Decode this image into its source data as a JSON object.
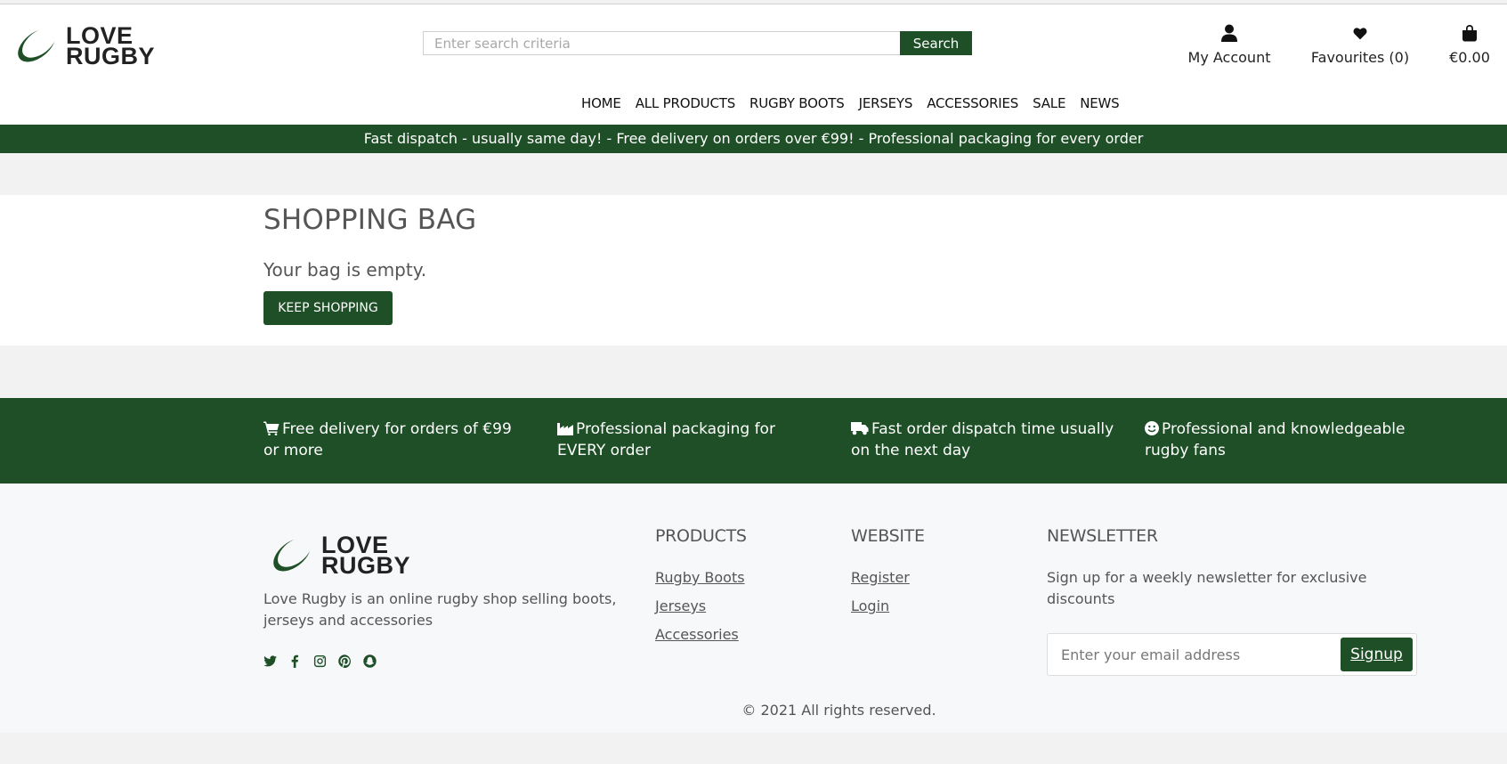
{
  "brand": {
    "line1": "LOVE",
    "line2": "RUGBY",
    "accent": "#1e4f27"
  },
  "search": {
    "placeholder": "Enter search criteria",
    "button_label": "Search"
  },
  "header_links": {
    "account_label": "My Account",
    "favourites_label": "Favourites (0)",
    "bag_total": "€0.00"
  },
  "nav": [
    "HOME",
    "ALL PRODUCTS",
    "RUGBY BOOTS",
    "JERSEYS",
    "ACCESSORIES",
    "SALE",
    "NEWS"
  ],
  "promo_text": "Fast dispatch - usually same day! - Free delivery on orders over €99! - Professional packaging for every order",
  "bag": {
    "title": "SHOPPING BAG",
    "empty_message": "Your bag is empty.",
    "keep_shopping_label": "KEEP SHOPPING"
  },
  "features": [
    {
      "icon": "cart-icon",
      "text": "Free delivery for orders of €99 or more"
    },
    {
      "icon": "industry-icon",
      "text": "Professional packaging for EVERY order"
    },
    {
      "icon": "truck-icon",
      "text": "Fast order dispatch time usually on the next day"
    },
    {
      "icon": "smile-icon",
      "text": "Professional and knowledgeable rugby fans"
    }
  ],
  "footer": {
    "about": "Love Rugby is an online rugby shop selling boots, jerseys and accessories",
    "social": [
      "twitter-icon",
      "facebook-icon",
      "instagram-icon",
      "pinterest-icon",
      "snapchat-icon"
    ],
    "products_heading": "PRODUCTS",
    "products_links": [
      "Rugby Boots",
      "Jerseys",
      "Accessories"
    ],
    "website_heading": "WEBSITE",
    "website_links": [
      "Register",
      "Login"
    ],
    "newsletter_heading": "NEWSLETTER",
    "newsletter_text": "Sign up for a weekly newsletter for exclusive discounts",
    "newsletter_placeholder": "Enter your email address",
    "signup_label": "Signup",
    "copyright": "© 2021 All rights reserved."
  }
}
